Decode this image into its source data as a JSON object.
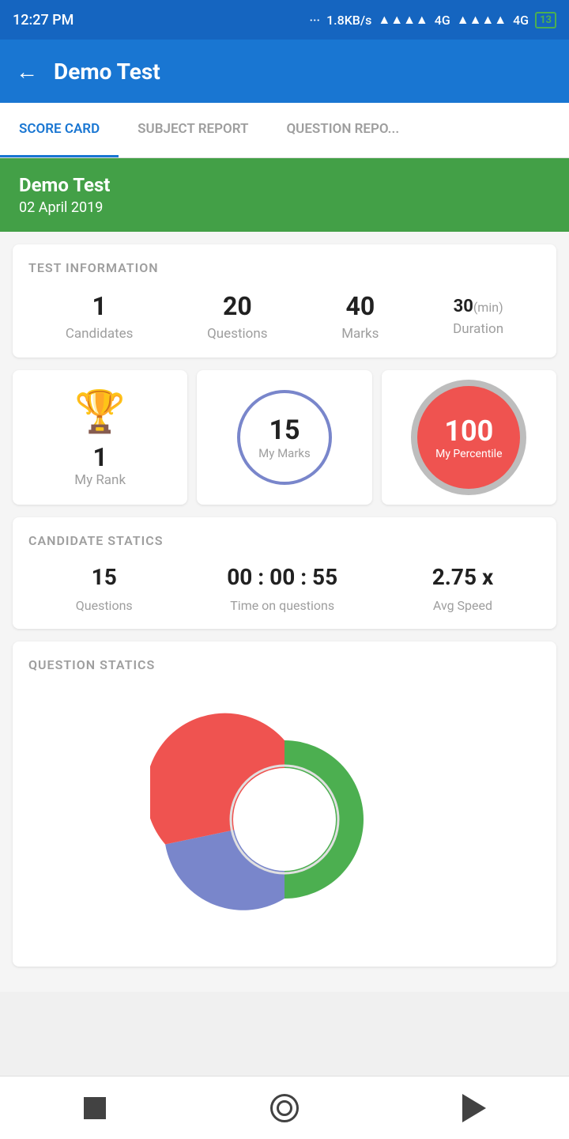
{
  "statusBar": {
    "time": "12:27 PM",
    "network": "1.8KB/s",
    "signal1": "4G",
    "signal2": "4G",
    "battery": "13"
  },
  "appBar": {
    "title": "Demo Test",
    "backLabel": "←"
  },
  "tabs": [
    {
      "label": "SCORE CARD",
      "active": true
    },
    {
      "label": "SUBJECT REPORT",
      "active": false
    },
    {
      "label": "QUESTION REPO...",
      "active": false
    }
  ],
  "testHeader": {
    "name": "Demo Test",
    "date": "02 April 2019"
  },
  "testInfo": {
    "title": "TEST INFORMATION",
    "candidates": {
      "value": "1",
      "label": "Candidates"
    },
    "questions": {
      "value": "20",
      "label": "Questions"
    },
    "marks": {
      "value": "40",
      "label": "Marks"
    },
    "duration": {
      "value": "30",
      "unit": "(min)",
      "label": "Duration"
    }
  },
  "metrics": {
    "rank": {
      "value": "1",
      "label": "My Rank"
    },
    "marks": {
      "value": "15",
      "label": "My Marks"
    },
    "percentile": {
      "value": "100",
      "label": "My Percentile"
    }
  },
  "candidateStatics": {
    "title": "CANDIDATE STATICS",
    "questions": {
      "value": "15",
      "label": "Questions"
    },
    "time": {
      "value": "00 : 00 : 55",
      "label": "Time on questions"
    },
    "avgSpeed": {
      "value": "2.75 x",
      "label": "Avg Speed"
    }
  },
  "questionStatics": {
    "title": "QUESTION STATICS",
    "chart": {
      "correct": 50,
      "skipped": 30,
      "incorrect": 20
    },
    "colors": {
      "correct": "#4caf50",
      "skipped": "#7986cb",
      "incorrect": "#ef5350"
    }
  },
  "bottomNav": {
    "stop": "stop",
    "home": "home",
    "back": "back"
  }
}
